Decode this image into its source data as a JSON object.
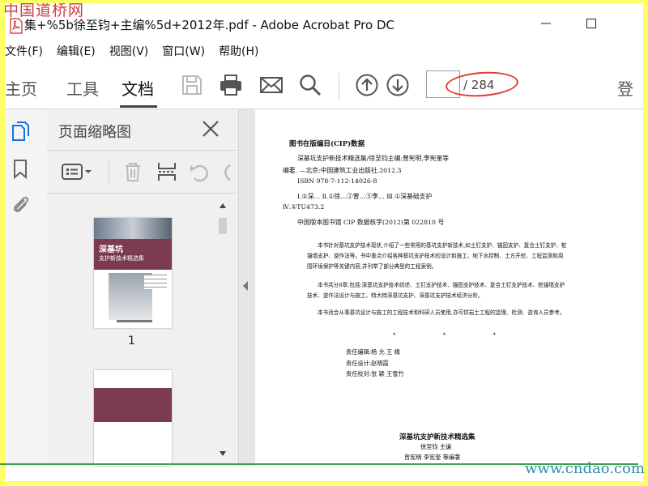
{
  "window": {
    "title": "集+%5b徐至钧+主编%5d+2012年.pdf - Adobe Acrobat Pro DC",
    "watermark_top": "中国道桥网",
    "watermark_bottom": "www.cndao.com"
  },
  "menu": [
    "文件(F)",
    "编辑(E)",
    "视图(V)",
    "窗口(W)",
    "帮助(H)"
  ],
  "tabs": {
    "home": "主页",
    "tools": "工具",
    "document": "文档",
    "active": "document"
  },
  "toolbar": {
    "icons": [
      "save-icon",
      "print-icon",
      "email-icon",
      "search-icon",
      "page-up-icon",
      "page-down-icon"
    ],
    "page_current": "",
    "page_total": "/ 284",
    "signin": "登",
    "highlight_color": "#e53935"
  },
  "sidebar": {
    "panel_title": "页面缩略图",
    "thumbnails": [
      {
        "label": "1",
        "cover_title": "深基坑",
        "cover_subtitle": "支护新技术精选集"
      },
      {
        "label": ""
      }
    ]
  },
  "document": {
    "cip_title": "图书在版编目(CIP)数据",
    "cip_lines": [
      "深基坑支护新技术精选集/徐至钧主编;曾宪明,李宪奎等",
      "编著. —北京:中国建筑工业出版社,2012.3",
      "ISBN 978-7-112-14026-8",
      "Ⅰ.①深…  Ⅱ.①徐…②曾…③李…  Ⅲ.①深基础支护",
      "Ⅳ.①TU473.2",
      "中国版本图书馆 CIP 数据核字(2012)第 022810 号"
    ],
    "description": [
      "本书针对基坑支护技术现状,介绍了一些常用的基坑支护新技术,如土钉支护、锚固支护、复合土钉支护、桩锚墙支护、逆作法等。书中重点介绍各种基坑支护技术的设计和施工、地下水控制、土方开挖、工程监测和周围环境保护等关键内容,并列举了部分典型的工程案例。",
      "本书共分8章,包括:深基坑支护技术综述、土钉支护技术、锚固支护技术、复合土钉支护技术、桩锚墙支护技术、逆作法设计与施工、特大特深基坑支护、深基坑支护技术经济分析。",
      "本书适合从事基坑设计与施工的工程技术和科研人员使用,亦可供岩土工程的监理、检测、咨询人员参考。"
    ],
    "stars": "* * *",
    "credits": [
      "责任编辑:杨 允 王 梅",
      "责任设计:赵明霞",
      "责任校对:张 颖 王雪竹"
    ],
    "book_title": "深基坑支护新技术精选集",
    "editor": "徐至钧  主编",
    "coauthors": "曾宪明  李宪奎  等编著"
  }
}
